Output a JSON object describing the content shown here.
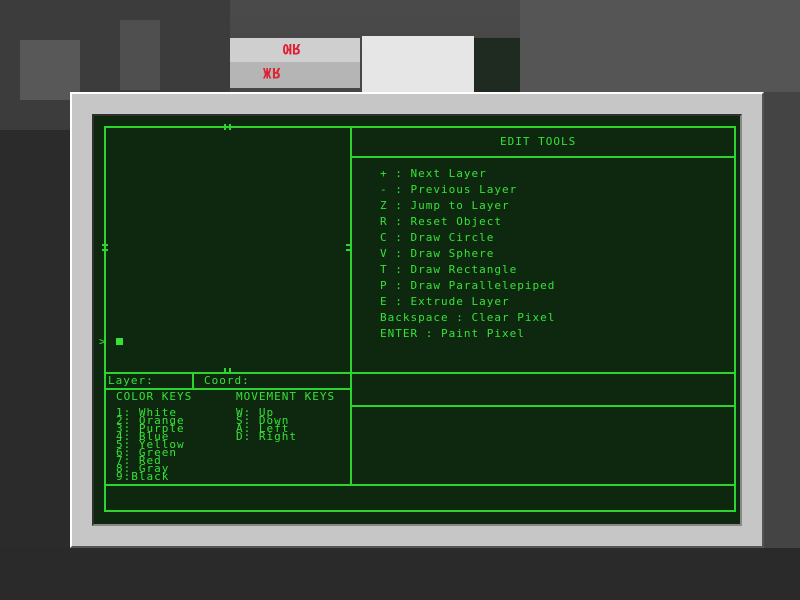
{
  "colors": {
    "terminal_bg": "#0e2810",
    "terminal_fg": "#36e236",
    "bezel": "#c6c6c6"
  },
  "background": {
    "sign_top": "ЯЮ",
    "sign_bottom": "ЯЖ"
  },
  "prompt": {
    "symbol": ">"
  },
  "status": {
    "layer_label": "Layer:",
    "coord_label": "Coord:"
  },
  "edit_tools": {
    "title": "EDIT TOOLS",
    "items": [
      "+ : Next Layer",
      "- : Previous Layer",
      "Z : Jump to Layer",
      "R : Reset Object",
      "C : Draw Circle",
      "V : Draw Sphere",
      "T : Draw Rectangle",
      "P : Draw Parallelepiped",
      "E : Extrude Layer",
      "Backspace : Clear Pixel",
      "ENTER : Paint Pixel"
    ]
  },
  "color_keys": {
    "title": "COLOR KEYS",
    "items": [
      "1: White",
      "2: Orange",
      "3: Purple",
      "4: Blue",
      "5: Yellow",
      "6: Green",
      "7: Red",
      "8: Gray",
      "9:Black"
    ]
  },
  "movement_keys": {
    "title": "MOVEMENT KEYS",
    "items": [
      "W: Up",
      "S: Down",
      "A: Left",
      "D: Right"
    ]
  }
}
